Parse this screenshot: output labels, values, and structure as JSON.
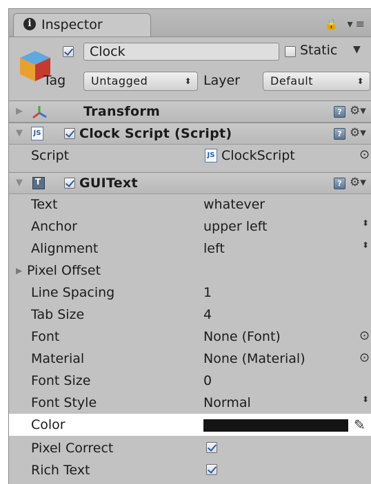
{
  "tab": {
    "title": "Inspector",
    "icons": "🔒 ▾≡"
  },
  "object": {
    "name": "Clock",
    "static_label": "Static",
    "tag_label": "Tag",
    "tag_value": "Untagged",
    "layer_label": "Layer",
    "layer_value": "Default"
  },
  "components": {
    "transform": {
      "title": "Transform"
    },
    "clock_script": {
      "title": "Clock Script (Script)",
      "script_label": "Script",
      "script_value": "ClockScript"
    },
    "guitext": {
      "title": "GUIText"
    }
  },
  "properties": [
    {
      "label": "Text",
      "value": "whatever"
    },
    {
      "label": "Anchor",
      "value": "upper left"
    },
    {
      "label": "Alignment",
      "value": "left"
    },
    {
      "label": "Pixel Offset",
      "value": ""
    },
    {
      "label": "Line Spacing",
      "value": "1"
    },
    {
      "label": "Tab Size",
      "value": "4"
    },
    {
      "label": "Font",
      "value": "None (Font)"
    },
    {
      "label": "Material",
      "value": "None (Material)"
    },
    {
      "label": "Font Size",
      "value": "0"
    },
    {
      "label": "Font Style",
      "value": "Normal"
    },
    {
      "label": "Color",
      "value": "#141414"
    },
    {
      "label": "Pixel Correct",
      "value": "checked"
    },
    {
      "label": "Rich Text",
      "value": "checked"
    }
  ],
  "colors": {
    "panel_bg": "#c2c2c2",
    "highlight_row": "#ffffff",
    "color_swatch": "#141414",
    "checkbox_tick": "#2a5da8"
  }
}
